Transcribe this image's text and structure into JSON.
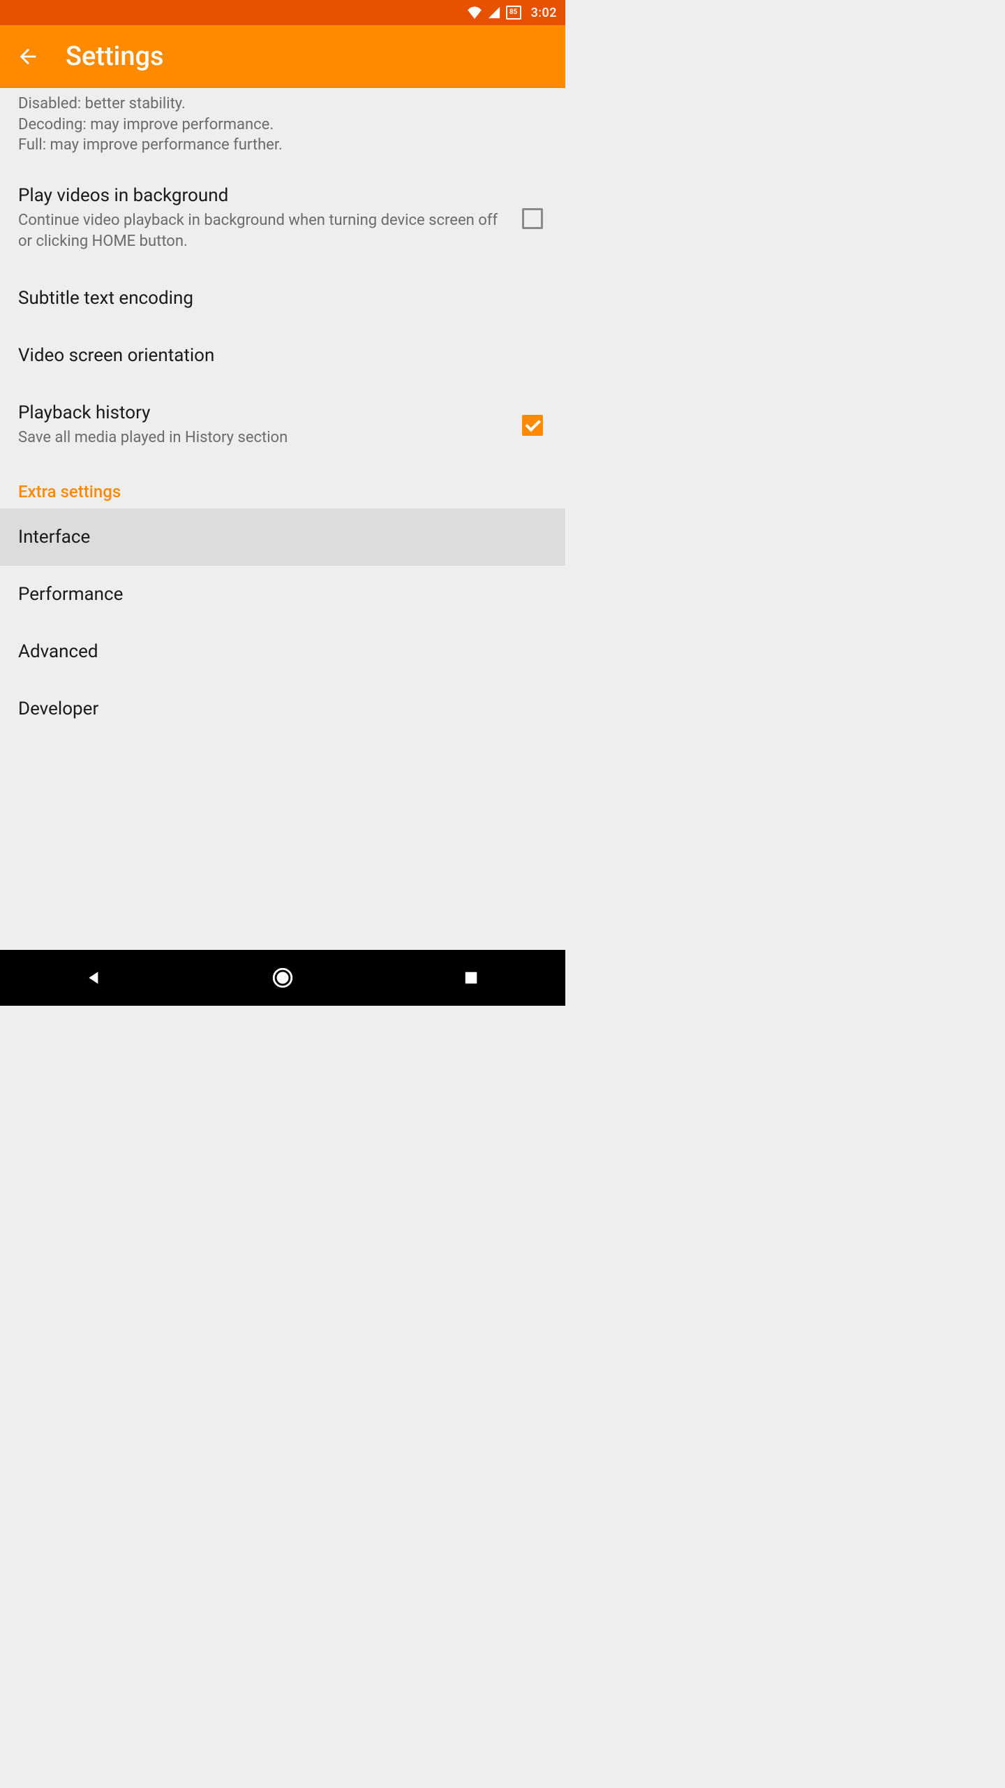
{
  "status": {
    "battery_level": "85",
    "time": "3:02"
  },
  "appbar": {
    "title": "Settings"
  },
  "decoding_desc": {
    "line1": "Disabled: better stability.",
    "line2": "Decoding: may improve performance.",
    "line3": "Full: may improve performance further."
  },
  "items": {
    "play_bg": {
      "title": "Play videos in background",
      "subtitle": "Continue video playback in background when turning device screen off or clicking HOME button.",
      "checked": false
    },
    "subtitle_encoding": {
      "title": "Subtitle text encoding"
    },
    "orientation": {
      "title": "Video screen orientation"
    },
    "playback_history": {
      "title": "Playback history",
      "subtitle": "Save all media played in History section",
      "checked": true
    }
  },
  "section": {
    "extra": "Extra settings"
  },
  "extra_items": {
    "interface": "Interface",
    "performance": "Performance",
    "advanced": "Advanced",
    "developer": "Developer"
  }
}
